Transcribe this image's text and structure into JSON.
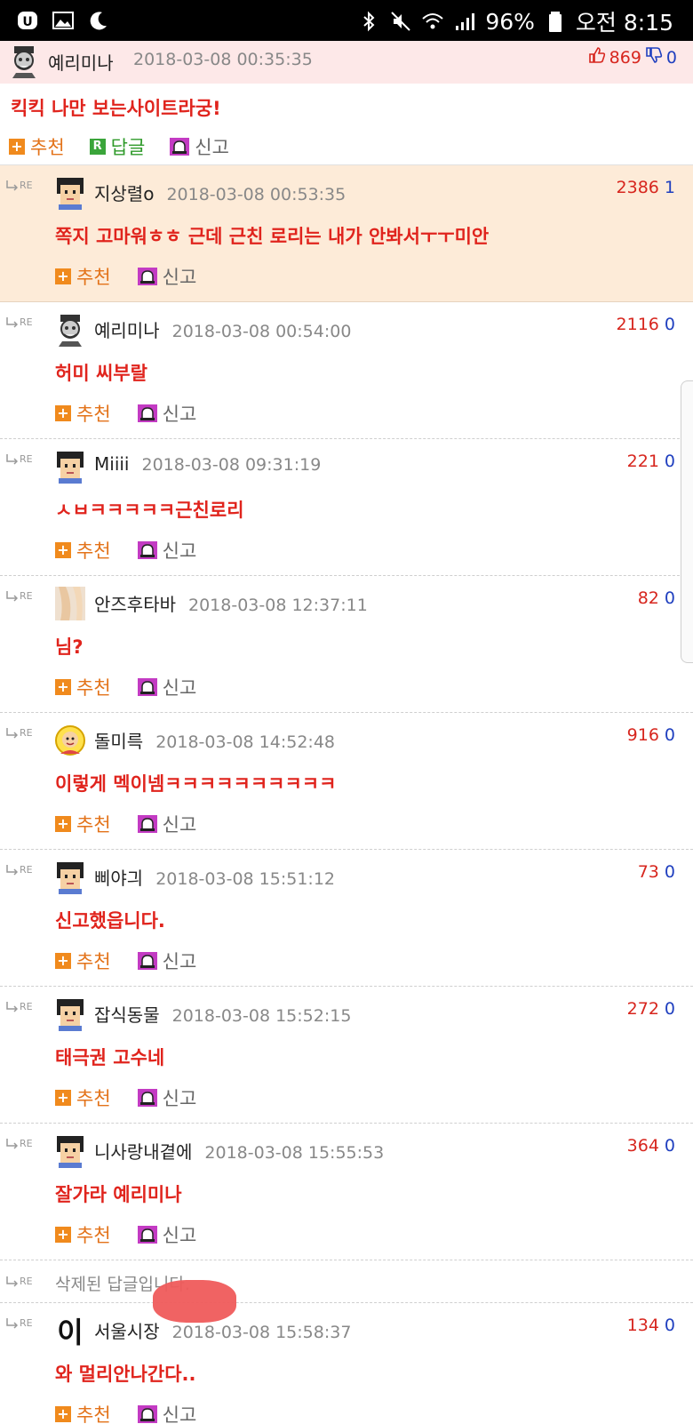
{
  "status_bar": {
    "battery": "96%",
    "time": "오전 8:15"
  },
  "post": {
    "author": "예리미나",
    "date": "2018-03-08 00:35:35",
    "up": "869",
    "down": "0",
    "content": "킥킥 나만 보는사이트라궁!",
    "recommend_label": "추천",
    "reply_label": "답글",
    "report_label": "신고"
  },
  "comment_labels": {
    "re": "RE",
    "recommend": "추천",
    "report": "신고"
  },
  "comments": [
    {
      "author": "지상렬o",
      "date": "2018-03-08 00:53:35",
      "up": "2386",
      "down": "1",
      "content": "쪽지 고마워ㅎㅎ 근데 근친 로리는 내가 안봐서ㅜㅜ미안",
      "avatar": "pixel-head"
    },
    {
      "author": "예리미나",
      "date": "2018-03-08 00:54:00",
      "up": "2116",
      "down": "0",
      "content": "허미 씨부랄",
      "avatar": "grandpa-head"
    },
    {
      "author": "Miiii",
      "date": "2018-03-08 09:31:19",
      "up": "221",
      "down": "0",
      "content": "ㅅㅂㅋㅋㅋㅋㅋ근친로리",
      "avatar": "pixel-head"
    },
    {
      "author": "안즈후타바",
      "date": "2018-03-08 12:37:11",
      "up": "82",
      "down": "0",
      "content": "님?",
      "avatar": "anime-avatar"
    },
    {
      "author": "돌미륵",
      "date": "2018-03-08 14:52:48",
      "up": "916",
      "down": "0",
      "content": "이렇게 멕이넴ㅋㅋㅋㅋㅋㅋㅋㅋㅋㅋ",
      "avatar": "cartoon-face"
    },
    {
      "author": "삐야긔",
      "date": "2018-03-08 15:51:12",
      "up": "73",
      "down": "0",
      "content": "신고했읍니다.",
      "avatar": "pixel-head"
    },
    {
      "author": "잡식동물",
      "date": "2018-03-08 15:52:15",
      "up": "272",
      "down": "0",
      "content": "태극권 고수네",
      "avatar": "pixel-head"
    },
    {
      "author": "니사랑내곁에",
      "date": "2018-03-08 15:55:53",
      "up": "364",
      "down": "0",
      "content": "잘가라 예리미나",
      "avatar": "pixel-head"
    }
  ],
  "deleted_notice": "삭제된 답글입니다.",
  "last_comment": {
    "author": "서울시장",
    "date": "2018-03-08 15:58:37",
    "up": "134",
    "down": "0",
    "content": "와 멀리안나간다..",
    "avatar_glyph": "이"
  }
}
